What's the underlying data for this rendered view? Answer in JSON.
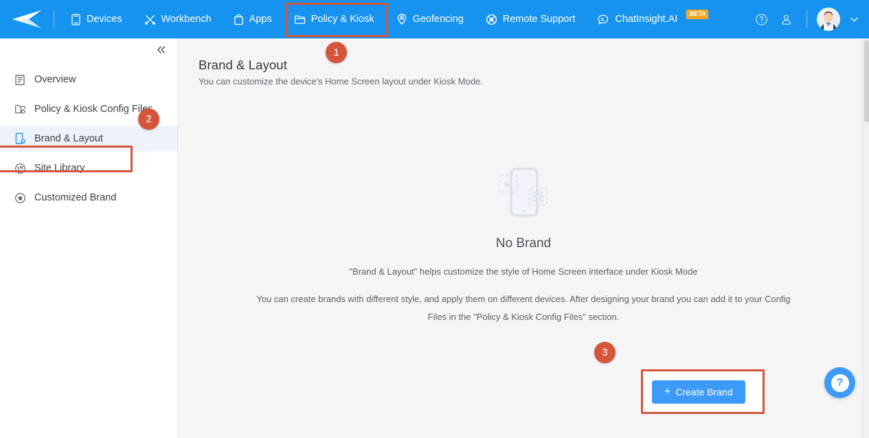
{
  "app": {
    "brand_color": "#1593ef",
    "accent_color": "#3d9bf7",
    "annotation_color": "#d4553a",
    "logo_name": "paper-plane-logo"
  },
  "topnav": {
    "items": [
      {
        "label": "Devices",
        "icon": "phone-icon",
        "active": false
      },
      {
        "label": "Workbench",
        "icon": "tools-icon",
        "active": false
      },
      {
        "label": "Apps",
        "icon": "shopping-bag-icon",
        "active": false
      },
      {
        "label": "Policy & Kiosk",
        "icon": "folder-icon",
        "active": true
      },
      {
        "label": "Geofencing",
        "icon": "map-pin-person-icon",
        "active": false
      },
      {
        "label": "Remote Support",
        "icon": "life-buoy-icon",
        "active": false
      },
      {
        "label": "ChatInsight.AI",
        "icon": "chat-ai-icon",
        "active": false,
        "badge": "BETA"
      }
    ],
    "right": {
      "help_icon": "help-circle-icon",
      "account_icon": "user-account-icon",
      "avatar": "user-avatar",
      "chevron": "chevron-down-icon"
    }
  },
  "sidebar": {
    "collapse_icon": "double-chevron-left-icon",
    "items": [
      {
        "label": "Overview",
        "icon": "document-icon",
        "selected": false
      },
      {
        "label": "Policy & Kiosk Config Files",
        "icon": "folder-config-icon",
        "selected": false
      },
      {
        "label": "Brand & Layout",
        "icon": "phone-config-icon",
        "selected": true
      },
      {
        "label": "Site Library",
        "icon": "globe-icon",
        "selected": false
      },
      {
        "label": "Customized Brand",
        "icon": "star-circle-icon",
        "selected": false
      }
    ]
  },
  "main": {
    "title": "Brand & Layout",
    "subtitle": "You can customize the device's Home Screen layout under Kiosk Mode.",
    "empty_state": {
      "illustration": "phone-brand-placeholder-illustration",
      "title": "No Brand",
      "line1": "\"Brand & Layout\" helps customize the style of Home Screen interface under Kiosk Mode",
      "line2": "You can create brands with different style, and apply them on different devices. After designing your brand you can add it to your Config Files in the \"Policy & Kiosk Config Files\" section."
    },
    "create_button": {
      "label": "Create Brand",
      "plus": "+"
    }
  },
  "annotations": {
    "badges": [
      {
        "number": "1",
        "target": "policy-kiosk-nav"
      },
      {
        "number": "2",
        "target": "sidebar-item-brand-layout"
      },
      {
        "number": "3",
        "target": "create-brand-button"
      }
    ]
  },
  "help": {
    "icon": "question-mark-icon",
    "label": "?"
  }
}
